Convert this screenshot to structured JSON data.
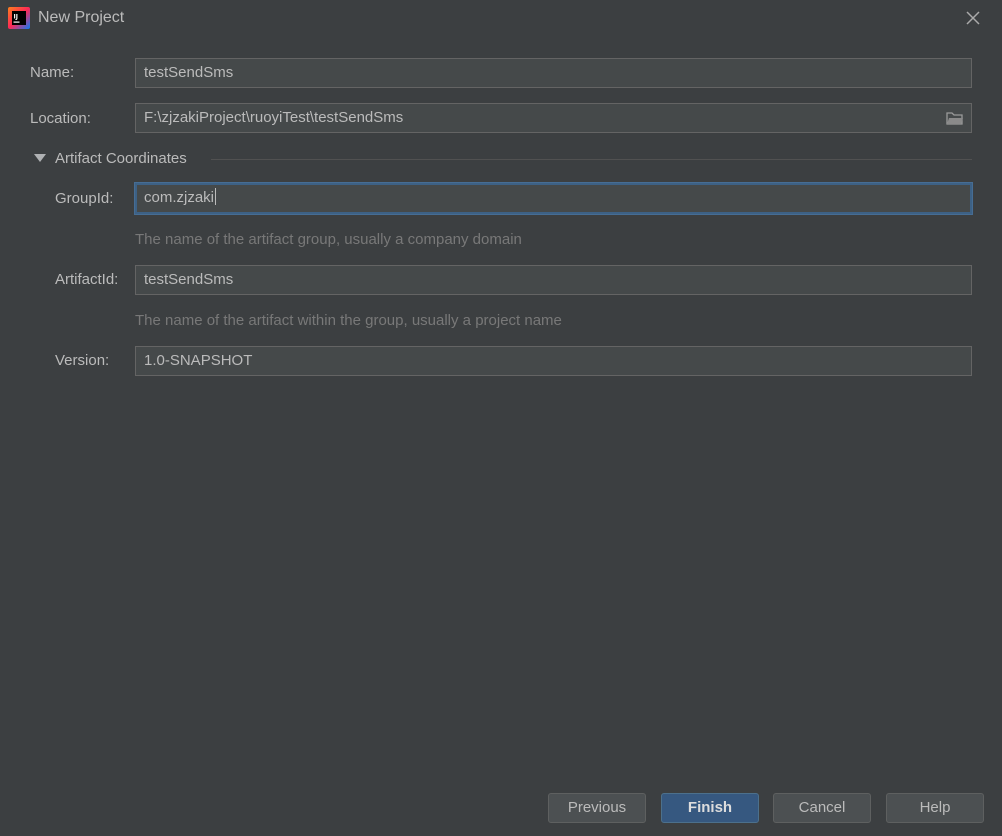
{
  "window": {
    "title": "New Project",
    "app_icon": "intellij-idea-icon",
    "close_icon": "close-icon"
  },
  "form": {
    "name": {
      "label": "Name:",
      "value": "testSendSms"
    },
    "location": {
      "label": "Location:",
      "value": "F:\\zjzakiProject\\ruoyiTest\\testSendSms",
      "browse_icon": "folder-icon"
    },
    "artifact_section": {
      "title": "Artifact Coordinates",
      "expanded": true
    },
    "group_id": {
      "label": "GroupId:",
      "value": "com.zjzaki",
      "hint": "The name of the artifact group, usually a company domain"
    },
    "artifact_id": {
      "label": "ArtifactId:",
      "value": "testSendSms",
      "hint": "The name of the artifact within the group, usually a project name"
    },
    "version": {
      "label": "Version:",
      "value": "1.0-SNAPSHOT"
    }
  },
  "buttons": {
    "previous": "Previous",
    "finish": "Finish",
    "cancel": "Cancel",
    "help": "Help"
  },
  "colors": {
    "background": "#3c3f41",
    "field_background": "#45494a",
    "focus_border": "#3d6185",
    "primary_button": "#365880",
    "hint_text": "#787878"
  }
}
